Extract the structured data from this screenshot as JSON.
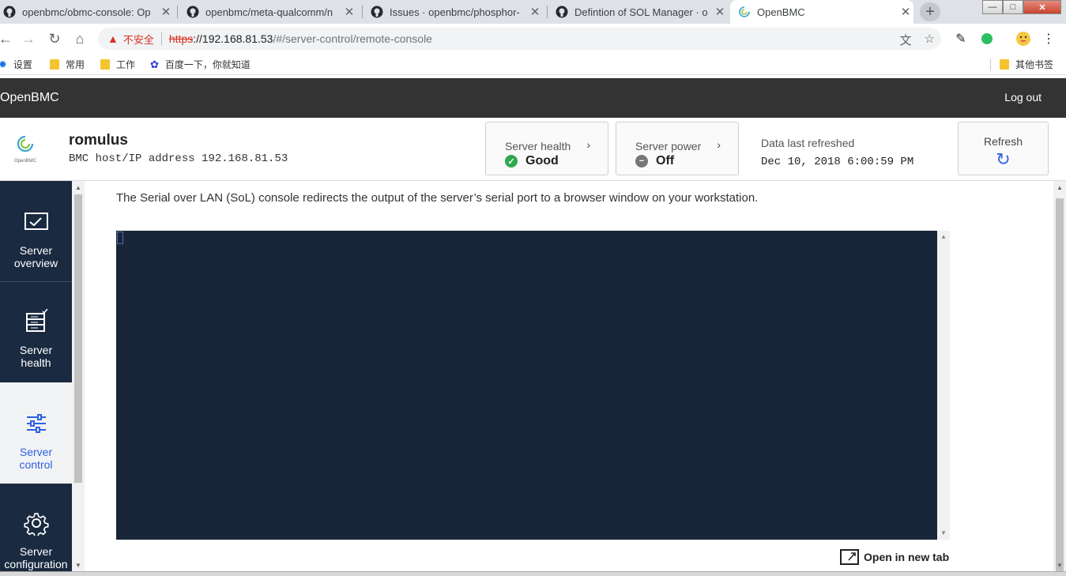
{
  "browser": {
    "tabs": [
      {
        "title": "openbmc/obmc-console: Op",
        "icon": "github-icon"
      },
      {
        "title": "openbmc/meta-qualcomm/n",
        "icon": "github-icon"
      },
      {
        "title": "Issues · openbmc/phosphor-",
        "icon": "github-icon"
      },
      {
        "title": "Defintion of SOL Manager · o",
        "icon": "github-icon"
      },
      {
        "title": "OpenBMC",
        "icon": "openbmc-icon"
      }
    ],
    "new_tab_label": "+",
    "window_buttons": {
      "minimize": "—",
      "maximize": "□",
      "close": "✕"
    },
    "address": {
      "security_label": "不安全",
      "url_scheme": "https",
      "url_sep": "://",
      "url_host": "192.168.81.53",
      "url_path": "/#/server-control/remote-console"
    },
    "bookmarks": [
      {
        "label": "设置",
        "icon": "gear-icon"
      },
      {
        "label": "常用",
        "icon": "folder-icon"
      },
      {
        "label": "工作",
        "icon": "folder-icon"
      },
      {
        "label": "百度一下，你就知道",
        "icon": "baidu-icon"
      }
    ],
    "other_bookmarks": "其他书签"
  },
  "app": {
    "brand": "OpenBMC",
    "logout": "Log out",
    "logo_caption": "OpenBMC"
  },
  "server": {
    "hostname": "romulus",
    "host_label": "BMC host/IP address",
    "host_ip": "192.168.81.53"
  },
  "status": {
    "health_label": "Server health",
    "health_value": "Good",
    "power_label": "Server power",
    "power_value": "Off",
    "refreshed_label": "Data last refreshed",
    "refreshed_value": "Dec 10, 2018 6:00:59 PM",
    "refresh_label": "Refresh"
  },
  "sidebar": {
    "items": [
      {
        "line1": "Server",
        "line2": "overview",
        "icon": "monitor-icon"
      },
      {
        "line1": "Server",
        "line2": "health",
        "icon": "server-health-icon"
      },
      {
        "line1": "Server",
        "line2": "control",
        "icon": "sliders-icon"
      },
      {
        "line1": "Server",
        "line2": "configuration",
        "icon": "gear-icon"
      }
    ]
  },
  "main": {
    "description": "The Serial over LAN (SoL) console redirects the output of the server’s serial port to a browser window on your workstation.",
    "open_new_tab": "Open in new tab"
  },
  "colors": {
    "header_bg": "#333333",
    "sidebar_bg": "#1a2a40",
    "terminal_bg": "#19253a",
    "accent": "#2d60e5",
    "good": "#2fa84f",
    "off": "#777777"
  }
}
